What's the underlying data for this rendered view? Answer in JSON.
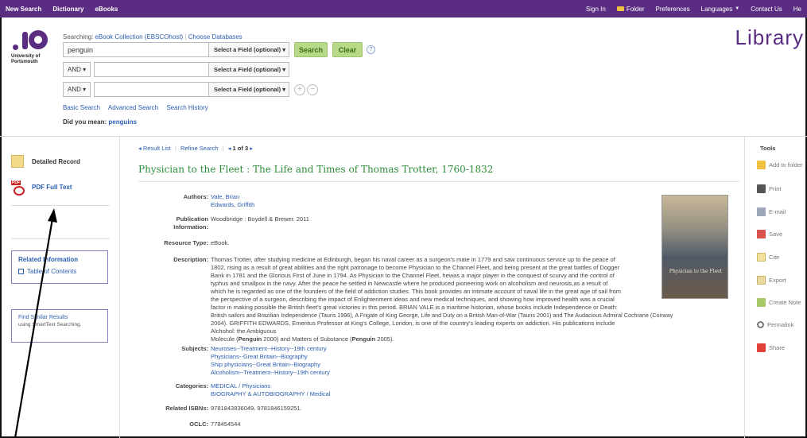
{
  "topbar": {
    "left": [
      "New Search",
      "Dictionary",
      "eBooks"
    ],
    "signin": "Sign In",
    "folder": "Folder",
    "preferences": "Preferences",
    "languages": "Languages",
    "contact": "Contact Us",
    "help": "He"
  },
  "header": {
    "logo_text_1": "University of",
    "logo_text_2": "Portsmouth",
    "library": "Library",
    "searching_prefix": "Searching:",
    "collection": "eBook Collection (EBSCOhost)",
    "choose_db": "Choose Databases",
    "query": "penguin",
    "field_placeholder": "Select a Field (optional)",
    "bool1": "AND",
    "bool2": "AND",
    "search_btn": "Search",
    "clear_btn": "Clear",
    "help_icon": "?",
    "add_row": "+",
    "remove_row": "−",
    "basic": "Basic Search",
    "advanced": "Advanced Search",
    "history": "Search History",
    "didyoumean_prefix": "Did you mean:",
    "suggestion": "penguins"
  },
  "left": {
    "detailed": "Detailed Record",
    "pdf": "PDF Full Text",
    "related_heading": "Related Information",
    "toc": "Table of Contents",
    "similar_heading": "Find Similar Results",
    "similar_sub": "using SmartText Searching."
  },
  "record": {
    "nav_result_list": "◂ Result List",
    "nav_refine": "Refine Search",
    "nav_prev": "◂",
    "nav_pos": "1 of 3",
    "nav_next": "▸",
    "title": "Physician to the Fleet : The Life and Times of Thomas Trotter, 1760-1832",
    "authors_label": "Authors:",
    "authors": [
      "Vale, Brian",
      "Edwards, Griffith"
    ],
    "pub_label_1": "Publication",
    "pub_label_2": "Information:",
    "publication": "Woodbridge : Boydell & Brewer. 2011",
    "type_label": "Resource Type:",
    "type": "eBook.",
    "desc_label": "Description:",
    "desc_lines": [
      "Thomas Trotter, after studying medicine at Edinburgh, began his naval career as a surgeon's mate in 1779 and saw continuous service up to the peace of",
      "1802, rising as a result of great abilities and the right patronage to become Physician to the Channel Fleet, and being present at the great battles of Dogger",
      "Bank in 1781 and the Glorious First of June in 1794. As Physician to the Channel Fleet, hewas a major player in the conquest of scurvy and the control of",
      "typhus and smallpox in the navy. After the peace he settled in Newcastle where he produced pioneering work on alcoholism and neurosis,as a result of",
      "which he is regarded as one of the founders of the field of addiction studies. This book provides an intimate account of naval life in the great age of sail from",
      "the perspective of a surgeon, describing the impact of Enlightenment ideas and new medical techniques, and showing how improved health was a crucial",
      "factor in making possible the British fleet's great victories in this period. BRIAN VALE is a maritime historian, whose books include Independence or Death:",
      "British sailors and Brazilian Independence (Tauris 1996), A Frigate of King George, Life and Duty on a British Man-of-War (Tauris 2001) and The Audacious Admiral Cochrane (Conway",
      "2004). GRIFFITH EDWARDS, Emeritus Professor at King's College, London, is one of the country's leading experts on addiction. His publications include Alchohol: the Ambiguous"
    ],
    "desc_last_a": "Molecule (",
    "desc_last_b": "Penguin",
    "desc_last_c": " 2000) and Matters of Substance (",
    "desc_last_d": "Penguin",
    "desc_last_e": " 2005).",
    "subjects_label": "Subjects:",
    "subjects": [
      "Neuroses--Treatment--History--19th century",
      "Physicians--Great Britain--Biography",
      "Ship physicians--Great Britain--Biography",
      "Alcoholism--Treatment--History--19th century"
    ],
    "categories_label": "Categories:",
    "categories": [
      "MEDICAL / Physicians",
      "BIOGRAPHY & AUTOBIOGRAPHY / Medical"
    ],
    "isbn_label": "Related ISBNs:",
    "isbns": "9781843836049. 9781846159251.",
    "oclc_label": "OCLC:",
    "oclc": "778454544",
    "cover_title": "Physician to the Fleet"
  },
  "tools": {
    "heading": "Tools",
    "items": [
      "Add to folder",
      "Print",
      "E-mail",
      "Save",
      "Cite",
      "Export",
      "Create Note",
      "Permalink",
      "Share"
    ]
  },
  "colors": {
    "brand_purple": "#5a2d82",
    "link_blue": "#2a5db0",
    "title_green": "#2e8b3a",
    "button_green": "#b8d98a"
  }
}
